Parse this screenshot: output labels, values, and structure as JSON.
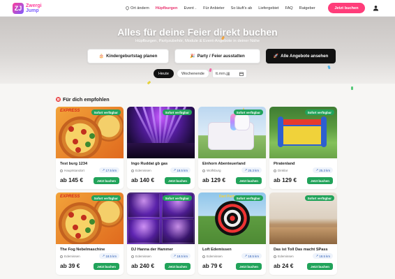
{
  "header": {
    "logo": {
      "badge": "ZJ",
      "line1": "Zwergi",
      "line2": "Jump"
    },
    "nav": [
      {
        "label": "Ort ändern",
        "kind": "location"
      },
      {
        "label": "Hüpfburgen",
        "kind": "active"
      },
      {
        "label": "Event",
        "kind": "dropdown"
      },
      {
        "label": "Für Anbieter",
        "kind": "plain"
      },
      {
        "label": "So läuft's ab",
        "kind": "plain"
      },
      {
        "label": "Liefergebiet",
        "kind": "plain"
      },
      {
        "label": "FAQ",
        "kind": "plain"
      },
      {
        "label": "Ratgeber",
        "kind": "plain"
      }
    ],
    "cta_label": "Jetzt buchen",
    "accent_color": "#ff3d7a"
  },
  "hero": {
    "title": "Alles für deine Feier direkt buchen",
    "subtitle": "Hüpfburgen, Partyzubehör, Module & Event-Angebote in deiner Nähe",
    "actions": [
      {
        "icon": "🎂",
        "label": "Kindergeburtstag planen",
        "style": "light"
      },
      {
        "icon": "🎉",
        "label": "Party / Feier ausstatten",
        "style": "light"
      },
      {
        "icon": "🚀",
        "label": "Alle Angebote ansehen",
        "style": "dark"
      }
    ],
    "date_filters": {
      "today": "Heute",
      "weekend": "Wochenende",
      "date_placeholder": "tt.mm.jjjj"
    }
  },
  "recommended": {
    "title": "Für dich empfohlen",
    "badge_label": "Sofort verfügbar",
    "book_label": "Jetzt buchen",
    "cards": [
      {
        "name": "Test burg 1234",
        "location": "Hauptstandort",
        "distance": "17.5 km",
        "price": "ab 145 €",
        "image": "pizza"
      },
      {
        "name": "Ingo Ruddat gb gas",
        "location": "Edemissen",
        "distance": "18.5 km",
        "price": "ab 140 €",
        "image": "club"
      },
      {
        "name": "Einhorn Abenteuerland",
        "location": "Wolfsburg",
        "distance": "25.3 km",
        "price": "ab 129 €",
        "image": "unicorn"
      },
      {
        "name": "Piratenland",
        "location": "Dinklar",
        "distance": "25.3 km",
        "price": "ab 129 €",
        "image": "garden"
      },
      {
        "name": "The Fog Nebelmaschine",
        "location": "Edemissen",
        "distance": "18.5 km",
        "price": "ab 39 €",
        "image": "pizza"
      },
      {
        "name": "DJ Hanna der Hammer",
        "location": "Edemissen",
        "distance": "18.5 km",
        "price": "ab 240 €",
        "image": "dj"
      },
      {
        "name": "Loft Edemissen",
        "location": "Edemissen",
        "distance": "18.5 km",
        "price": "ab 79 €",
        "image": "dart"
      },
      {
        "name": "Das ist Toll Das macht SPass",
        "location": "Edemissen",
        "distance": "18.5 km",
        "price": "ab 24 €",
        "image": "table"
      }
    ]
  }
}
